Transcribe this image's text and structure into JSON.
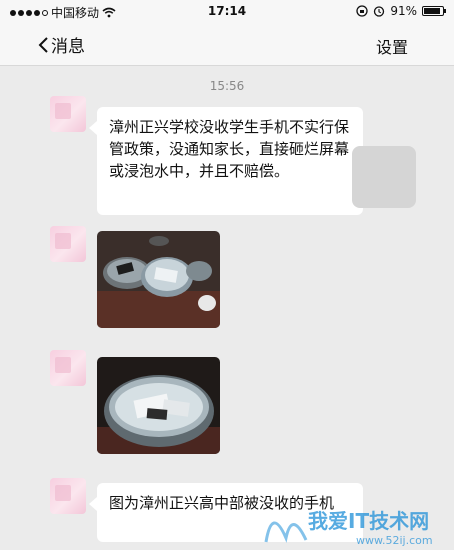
{
  "status_bar": {
    "carrier": "中国移动",
    "time": "17:14",
    "battery": "91%",
    "battery_level": 0.91
  },
  "nav": {
    "back_label": "消息",
    "settings_label": "设置"
  },
  "chat": {
    "timestamp": "15:56",
    "messages": [
      {
        "type": "text",
        "text": "漳州正兴学校没收学生手机不实行保管政策，没通知家长，直接砸烂屏幕或浸泡水中，并且不赔偿。"
      },
      {
        "type": "image",
        "icon": "phones-in-basins-photo"
      },
      {
        "type": "image",
        "icon": "phones-in-water-basin-photo"
      },
      {
        "type": "text",
        "text": "图为漳州正兴高中部被没收的手机"
      }
    ]
  },
  "watermark": {
    "name": "我爱IT技术网",
    "url": "www.52ij.com"
  },
  "colors": {
    "background": "#ebebeb",
    "bar": "#f7f7f7",
    "bubble": "#ffffff",
    "watermark_blue": "#1f8fd8"
  }
}
